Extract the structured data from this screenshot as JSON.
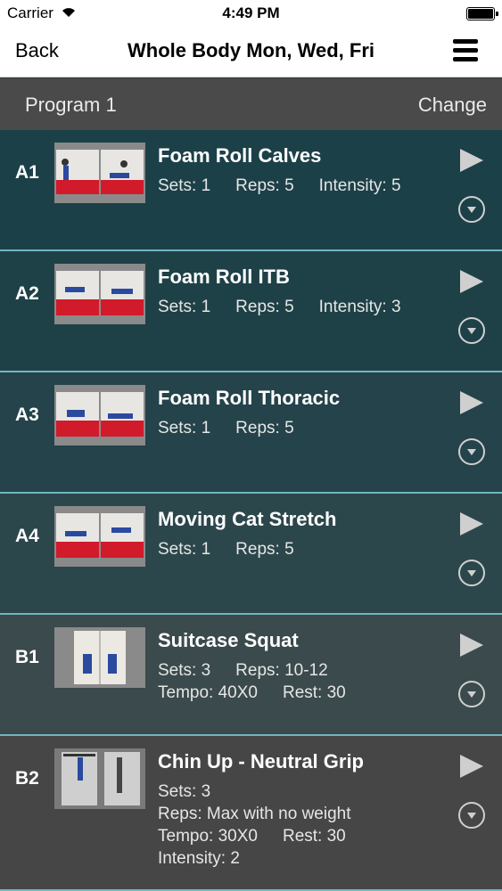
{
  "status_bar": {
    "carrier": "Carrier",
    "time": "4:49 PM"
  },
  "nav": {
    "back_label": "Back",
    "title": "Whole Body Mon, Wed, Fri"
  },
  "program": {
    "label": "Program 1",
    "change_label": "Change"
  },
  "exercises": [
    {
      "code": "A1",
      "name": "Foam Roll Calves",
      "lines": [
        [
          "Sets: 1",
          "Reps: 5",
          "Intensity: 5"
        ]
      ]
    },
    {
      "code": "A2",
      "name": "Foam Roll ITB",
      "lines": [
        [
          "Sets: 1",
          "Reps: 5",
          "Intensity: 3"
        ]
      ]
    },
    {
      "code": "A3",
      "name": "Foam Roll Thoracic",
      "lines": [
        [
          "Sets: 1",
          "Reps: 5"
        ]
      ]
    },
    {
      "code": "A4",
      "name": "Moving Cat Stretch",
      "lines": [
        [
          "Sets: 1",
          "Reps: 5"
        ]
      ]
    },
    {
      "code": "B1",
      "name": "Suitcase Squat",
      "lines": [
        [
          "Sets: 3",
          "Reps: 10-12"
        ],
        [
          "Tempo: 40X0",
          "Rest: 30"
        ]
      ]
    },
    {
      "code": "B2",
      "name": "Chin Up - Neutral Grip",
      "lines": [
        [
          "Sets: 3"
        ],
        [
          "Reps: Max with no weight"
        ],
        [
          "Tempo: 30X0",
          "Rest: 30"
        ],
        [
          "Intensity: 2"
        ]
      ]
    }
  ],
  "colors": {
    "row_backgrounds": [
      "#1c4048",
      "#1e4147",
      "#24434a",
      "#2c474c",
      "#3b4a4c",
      "#464646"
    ],
    "separator": "#6fb7c1"
  },
  "icons": {
    "play": "play-icon",
    "expand": "chevron-down-circle-icon",
    "menu": "hamburger-menu-icon",
    "wifi": "wifi-icon",
    "battery": "battery-icon"
  }
}
